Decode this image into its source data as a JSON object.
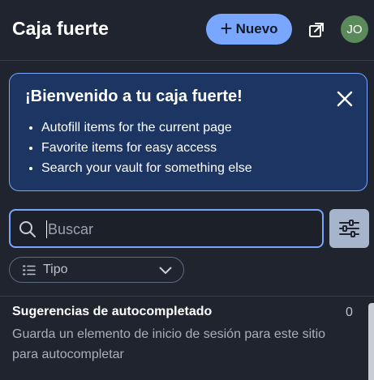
{
  "header": {
    "title": "Caja fuerte",
    "new_button": "Nuevo",
    "avatar_initials": "JO",
    "new_icon": "plus-icon",
    "popout_icon": "popout-icon"
  },
  "welcome": {
    "title": "¡Bienvenido a tu caja fuerte!",
    "items": [
      "Autofill items for the current page",
      "Favorite items for easy access",
      "Search your vault for something else"
    ],
    "close_icon": "close-icon"
  },
  "search": {
    "placeholder": "Buscar",
    "value": "",
    "icon": "search-icon",
    "filter_icon": "sliders-icon"
  },
  "filter": {
    "type_label": "Tipo",
    "icon": "list-icon",
    "chevron": "chevron-down-icon"
  },
  "suggestions": {
    "title": "Sugerencias de autocompletado",
    "count": "0",
    "description": "Guarda un elemento de inicio de sesión para este sitio para autocompletar"
  },
  "colors": {
    "background": "#1f242e",
    "accent": "#79a7ff",
    "banner_bg": "#1c3562",
    "avatar": "#5b8a5a"
  }
}
